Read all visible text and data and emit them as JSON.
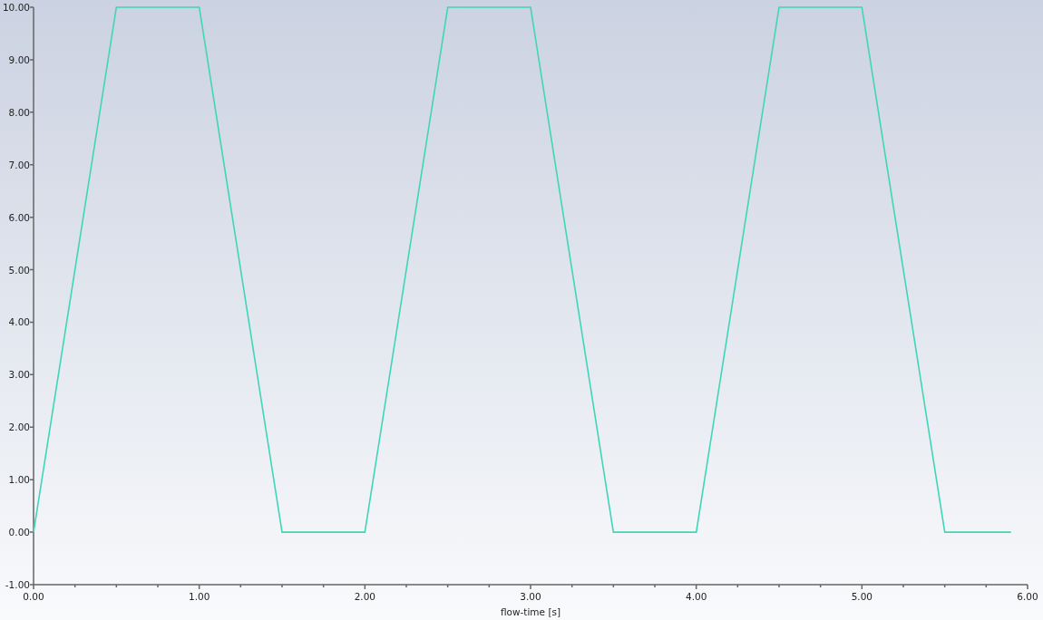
{
  "chart_data": {
    "type": "line",
    "xlabel": "flow-time [s]",
    "x": [
      0,
      0.5,
      1,
      1.5,
      1.9,
      2,
      2.5,
      3,
      3.5,
      3.9,
      4,
      4.5,
      5,
      5.5,
      5.9
    ],
    "series": [
      {
        "color": "#3fd6b8",
        "values": [
          0,
          10,
          10,
          0,
          0,
          0,
          10,
          10,
          0,
          0,
          0,
          10,
          10,
          0,
          0
        ]
      }
    ],
    "xlim": [
      0,
      6
    ],
    "ylim": [
      -1,
      10
    ],
    "xticks": [
      {
        "value": 0,
        "label": "0.00"
      },
      {
        "value": 1,
        "label": "1.00"
      },
      {
        "value": 2,
        "label": "2.00"
      },
      {
        "value": 3,
        "label": "3.00"
      },
      {
        "value": 4,
        "label": "4.00"
      },
      {
        "value": 5,
        "label": "5.00"
      },
      {
        "value": 6,
        "label": "6.00"
      }
    ],
    "yticks": [
      {
        "value": -1,
        "label": "-1.00"
      },
      {
        "value": 0,
        "label": "0.00"
      },
      {
        "value": 1,
        "label": "1.00"
      },
      {
        "value": 2,
        "label": "2.00"
      },
      {
        "value": 3,
        "label": "3.00"
      },
      {
        "value": 4,
        "label": "4.00"
      },
      {
        "value": 5,
        "label": "5.00"
      },
      {
        "value": 6,
        "label": "6.00"
      },
      {
        "value": 7,
        "label": "7.00"
      },
      {
        "value": 8,
        "label": "8.00"
      },
      {
        "value": 9,
        "label": "9.00"
      },
      {
        "value": 10,
        "label": "10.00"
      }
    ]
  }
}
